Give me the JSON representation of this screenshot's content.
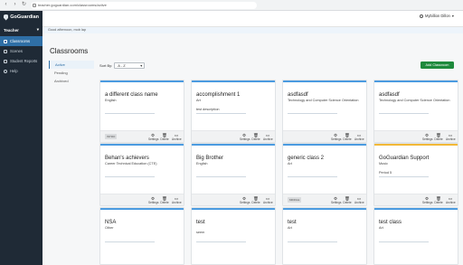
{
  "browser": {
    "url": "teacher.goguardian.com/classrooms/active"
  },
  "sidebar": {
    "brand": "GoGuardian",
    "role": "Teacher",
    "items": [
      {
        "label": "Classrooms",
        "icon": "grid-icon"
      },
      {
        "label": "Scenes",
        "icon": "scenes-icon"
      },
      {
        "label": "Student Reports",
        "icon": "reports-icon"
      },
      {
        "label": "Help",
        "icon": "help-icon"
      }
    ]
  },
  "header": {
    "user": "Mybillion Dillon"
  },
  "banner": {
    "text": "Good afternoon, mob lap"
  },
  "main": {
    "title": "Classrooms",
    "filters": [
      "Active",
      "Pending",
      "Archived"
    ],
    "sort_label": "Sort By:",
    "sort_value": "A - Z",
    "add_button": "Add Classroom"
  },
  "action_labels": {
    "settings": "Settings",
    "delete": "Delete",
    "archive": "Archive"
  },
  "cards": [
    {
      "title": "a different class name",
      "subject": "English",
      "desc": "",
      "tag": "INTRO"
    },
    {
      "title": "accomplishment 1",
      "subject": "Art",
      "desc": "test description",
      "tag": ""
    },
    {
      "title": "asdfasdf",
      "subject": "Technology and Computer Science Orientation",
      "desc": "",
      "tag": ""
    },
    {
      "title": "asdfasdf",
      "subject": "Technology and Computer Science Orientation",
      "desc": "",
      "tag": ""
    },
    {
      "title": "Behan's achievers",
      "subject": "Career Technical Education (CTE)",
      "desc": "",
      "tag": ""
    },
    {
      "title": "Big Brother",
      "subject": "English",
      "desc": "",
      "tag": ""
    },
    {
      "title": "generic class 2",
      "subject": "Art",
      "desc": "",
      "tag": "MIDDLE"
    },
    {
      "title": "GoGuardian Support",
      "subject": "Music",
      "desc": "Period 5",
      "tag": ""
    },
    {
      "title": "NSA",
      "subject": "Other",
      "desc": "",
      "tag": ""
    },
    {
      "title": "test",
      "subject": "",
      "desc": "seem",
      "tag": ""
    },
    {
      "title": "test",
      "subject": "Art",
      "desc": "",
      "tag": ""
    },
    {
      "title": "test class",
      "subject": "Art",
      "desc": "",
      "tag": ""
    }
  ],
  "colors": {
    "sidebar_bg": "#1f2a36",
    "active_nav": "#2f6fa6",
    "card_stripe": "#4b9be0",
    "card_stripe_alt": "#f2b838",
    "add_button_bg": "#1e8a3c"
  }
}
